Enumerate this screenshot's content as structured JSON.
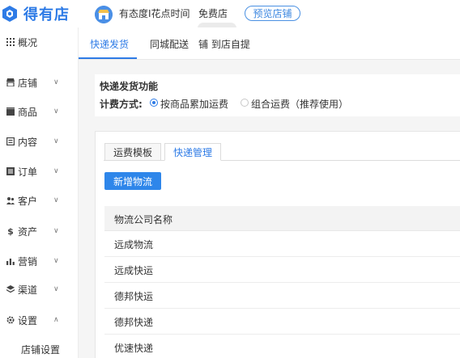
{
  "app": {
    "logo_text": "得有店",
    "shop_name": "有态度I花点时间",
    "plan": "免费店",
    "preview_label": "预览店铺"
  },
  "sidebar": {
    "items": [
      {
        "label": "概况",
        "icon": "grid-icon",
        "chevron": ""
      },
      {
        "label": "店铺",
        "icon": "store-icon",
        "chevron": "∨"
      },
      {
        "label": "商品",
        "icon": "goods-icon",
        "chevron": "∨"
      },
      {
        "label": "内容",
        "icon": "content-icon",
        "chevron": "∨"
      },
      {
        "label": "订单",
        "icon": "order-icon",
        "chevron": "∨"
      },
      {
        "label": "客户",
        "icon": "customer-icon",
        "chevron": "∨"
      },
      {
        "label": "资产",
        "icon": "dollar-icon",
        "chevron": "∨"
      },
      {
        "label": "营销",
        "icon": "bar-chart-icon",
        "chevron": "∨"
      },
      {
        "label": "渠道",
        "icon": "layers-icon",
        "chevron": "∨"
      },
      {
        "label": "设置",
        "icon": "gear-icon",
        "chevron": "∧"
      }
    ],
    "sub_item": "店铺设置"
  },
  "tabs": {
    "items": [
      "快递发货",
      "同城配送",
      "铺 到店自提"
    ],
    "active": 0
  },
  "delivery": {
    "title": "快递发货功能",
    "fee_label": "计费方式:",
    "option1": "按商品累加运费",
    "option2": "组合运费（推荐使用）",
    "selected": 0
  },
  "subtabs": {
    "items": [
      "运费模板",
      "快递管理"
    ],
    "active": 1
  },
  "add_button": "新增物流",
  "table": {
    "header": "物流公司名称",
    "rows": [
      "远成物流",
      "远成快运",
      "德邦快运",
      "德邦快递",
      "优速快递"
    ]
  },
  "colors": {
    "accent": "#2e7be6",
    "button": "#2e86ea",
    "background": "#f5f5f5"
  }
}
